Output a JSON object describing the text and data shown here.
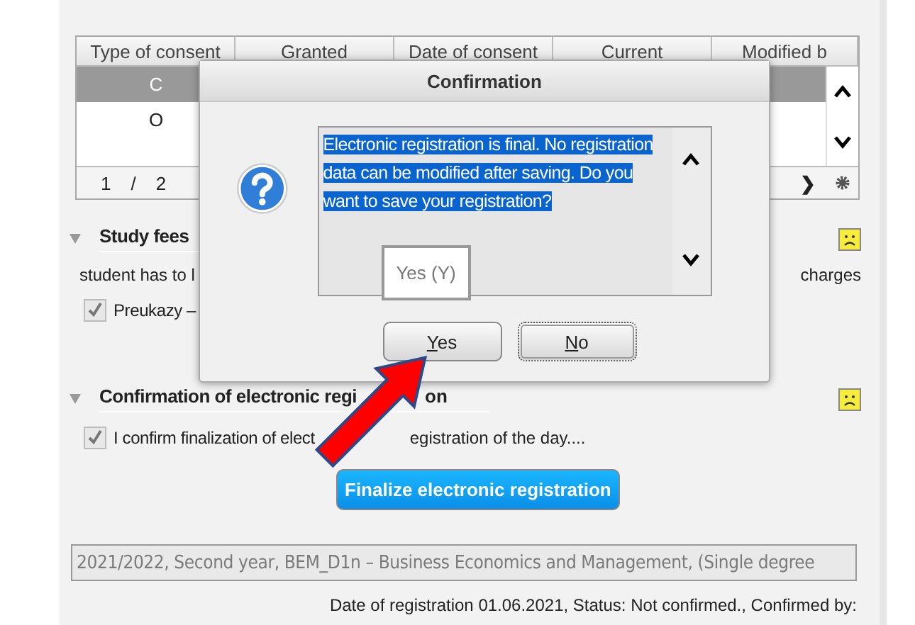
{
  "table": {
    "columns": [
      "Type of consent",
      "Granted",
      "Date of consent",
      "Current",
      "Modified b"
    ],
    "rows": [
      {
        "cells": [
          "C"
        ],
        "selected": true
      },
      {
        "cells": [
          "O"
        ],
        "selected": false
      }
    ],
    "pager": {
      "page": "1",
      "separator": "/",
      "total": "2",
      "next": "❯"
    }
  },
  "sections": [
    {
      "title": "Study fees",
      "expanded": true,
      "texts": [
        "student has to l",
        "charges"
      ],
      "checkboxes": [
        {
          "label": "Preukazy –",
          "checked": true
        }
      ]
    },
    {
      "title": "Confirmation of electronic regi",
      "title_tail": "on",
      "expanded": true,
      "checkboxes": [
        {
          "label": "I confirm finalization of elect",
          "label_tail": "egistration of the day....",
          "checked": true
        }
      ],
      "button": "Finalize electronic registration"
    }
  ],
  "registration_field": {
    "value": "2021/2022, Second year, BEM_D1n – Business Economics and Management, (Single degree"
  },
  "status": "Date of registration 01.06.2021, Status: Not confirmed., Confirmed by:",
  "dialog": {
    "title": "Confirmation",
    "message": "Electronic registration is final. No registration data can be modified after saving. Do you want to save your registration?",
    "tooltip": "Yes (Y)",
    "buttons": [
      {
        "label": "Yes",
        "focused": false
      },
      {
        "label": "No",
        "focused": true
      }
    ]
  }
}
